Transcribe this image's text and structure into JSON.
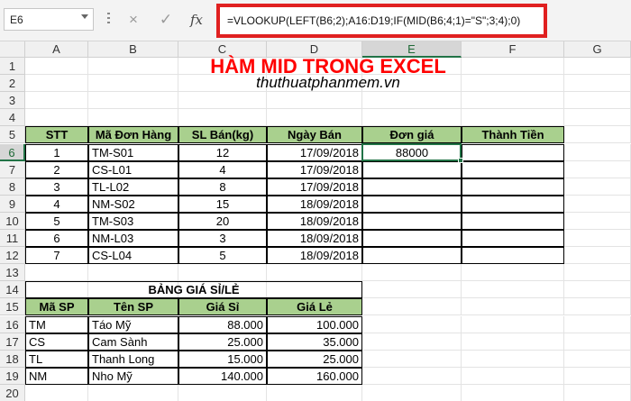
{
  "formula_bar": {
    "name_box": "E6",
    "cancel_icon": "×",
    "enter_icon": "✓",
    "fx_label": "fx",
    "formula": "=VLOOKUP(LEFT(B6;2);A16:D19;IF(MID(B6;4;1)=\"S\";3;4);0)"
  },
  "columns": [
    "A",
    "B",
    "C",
    "D",
    "E",
    "F",
    "G"
  ],
  "selected_cell": "E6",
  "rows": [
    "1",
    "2",
    "3",
    "4",
    "5",
    "6",
    "7",
    "8",
    "9",
    "10",
    "11",
    "12",
    "13",
    "14",
    "15",
    "16",
    "17",
    "18",
    "19",
    "20"
  ],
  "title": "HÀM MID TRONG EXCEL",
  "subtitle": "thuthuatphanmem.vn",
  "main_table": {
    "headers": [
      "STT",
      "Mã Đơn Hàng",
      "SL Bán(kg)",
      "Ngày Bán",
      "Đơn giá",
      "Thành Tiền"
    ],
    "rows": [
      [
        "1",
        "TM-S01",
        "12",
        "17/09/2018",
        "88000",
        ""
      ],
      [
        "2",
        "CS-L01",
        "4",
        "17/09/2018",
        "",
        ""
      ],
      [
        "3",
        "TL-L02",
        "8",
        "17/09/2018",
        "",
        ""
      ],
      [
        "4",
        "NM-S02",
        "15",
        "18/09/2018",
        "",
        ""
      ],
      [
        "5",
        "TM-S03",
        "20",
        "18/09/2018",
        "",
        ""
      ],
      [
        "6",
        "NM-L03",
        "3",
        "18/09/2018",
        "",
        ""
      ],
      [
        "7",
        "CS-L04",
        "5",
        "18/09/2018",
        "",
        ""
      ]
    ]
  },
  "price_table": {
    "title": "BẢNG GIÁ SỈ/LẺ",
    "headers": [
      "Mã SP",
      "Tên SP",
      "Giá Sỉ",
      "Giá Lẻ"
    ],
    "rows": [
      [
        "TM",
        "Táo Mỹ",
        "88.000",
        "100.000"
      ],
      [
        "CS",
        "Cam Sành",
        "25.000",
        "35.000"
      ],
      [
        "TL",
        "Thanh Long",
        "15.000",
        "25.000"
      ],
      [
        "NM",
        "Nho Mỹ",
        "140.000",
        "160.000"
      ]
    ]
  },
  "colors": {
    "header_green": "#a9d08e",
    "title_red": "#ff0000",
    "selection_green": "#217346",
    "formula_highlight": "#e02020"
  }
}
